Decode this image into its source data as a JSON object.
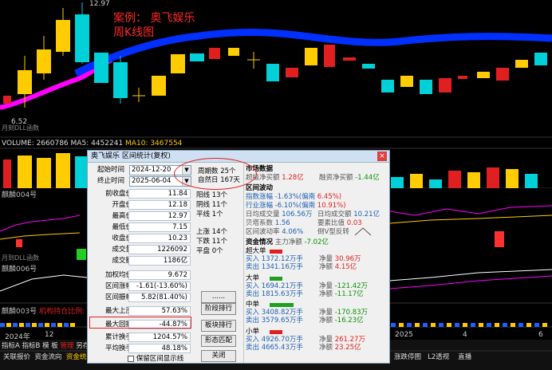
{
  "annotation": {
    "line1": "案例：  奥飞娱乐",
    "line2": "周K线图"
  },
  "chart_labels": {
    "high_price": "12.97",
    "low_price": "6.52",
    "ind1": "月刻DLL函数"
  },
  "volume_bar": {
    "volume": "VOLUME: 2660786",
    "ma5": "MA5: 4452241",
    "ma10": "MA10: 3467554"
  },
  "panels": {
    "p1": "麒麟004号",
    "p2": "麒麟006号",
    "p3": "月到DLL函数",
    "p4": "麒麟003号",
    "p4_ratio": "机构持仓比例: 39"
  },
  "date_axis": {
    "y2024": "2024年",
    "m12": "12",
    "y2025": "2025",
    "d4": "4",
    "d6": "6"
  },
  "bottom": {
    "row1": [
      "指标A",
      "指标B",
      "模",
      "板",
      "管理",
      "另存为"
    ],
    "row2": [
      "关联报价",
      "资金流向",
      "资金统"
    ],
    "right_tabs": [
      "涨跌停图",
      "L2透视",
      "直播"
    ]
  },
  "dialog": {
    "title": "奥飞娱乐  区间统计(复权)",
    "start_label": "起始时间",
    "start_value": "2024-12-20",
    "end_label": "终止时间",
    "end_value": "2025-06-04",
    "rows": [
      {
        "label": "前收盘价",
        "value": "11.84"
      },
      {
        "label": "开盘价",
        "value": "12.18"
      },
      {
        "label": "最高价",
        "value": "12.97"
      },
      {
        "label": "最低价",
        "value": "7.15"
      },
      {
        "label": "收盘价",
        "value": "10.23"
      },
      {
        "label": "成交量",
        "value": "1226092"
      },
      {
        "label": "成交额",
        "value": "1186亿"
      },
      {
        "label": "加权均价",
        "value": "9.672"
      },
      {
        "label": "区间涨幅",
        "value": "-1.61(-13.60%)"
      },
      {
        "label": "区间振幅",
        "value": "5.82(81.40%)"
      },
      {
        "label": "最大上涨",
        "value": "57.63%"
      },
      {
        "label": "最大回撤",
        "value": "-44.87%"
      },
      {
        "label": "累计换手",
        "value": "1204.57%"
      },
      {
        "label": "平均换手",
        "value": "48.18%"
      }
    ],
    "period": {
      "weeks": "周期数  25个",
      "natural": "自然日  167天"
    },
    "mid": {
      "up": "阳线  13个",
      "down": "阴线  11个",
      "flat": "平线  1个",
      "rise": "上涨  14个",
      "fall": "下跌  11个",
      "level": "平盘  0个"
    },
    "show_check": "保留区间显示线",
    "buttons": {
      "more": "......",
      "phase": "阶段排行",
      "block": "板块排行",
      "shape": "形态匹配",
      "close": "关闭"
    },
    "market": {
      "title": "市场数据",
      "main_buy": "超级净买额",
      "main_buy_v": "1.28亿",
      "fin_buy": "融资净买额",
      "fin_buy_v": "-1.44亿"
    },
    "range": {
      "title": "区间波动",
      "index_up": "指数涨幅 -1.63%(偏南",
      "index_up_v": "6.45%)",
      "ind_up": "行业涨幅 -6.10%(偏南",
      "ind_up_v": "10.91%)",
      "avg_vol": "日均成交量",
      "avg_vol_v": "106.56万",
      "avg_amt": "日均成交额",
      "avg_amt_v": "10.21亿",
      "beta": "贝塔系数",
      "beta_v": "1.56",
      "reload": "要素比值",
      "reload_v": "0.03",
      "vol": "区间波动率",
      "vol_v": "4.06%",
      "shape": "倒V型反转"
    },
    "fund": {
      "title": "资金情况",
      "main_net": "主力净额",
      "main_net_v": "-7.02亿",
      "groups": [
        {
          "name": "超大单",
          "color": "#e02020",
          "buy": "买入 1372.12万手",
          "sell": "卖出 1341.16万手",
          "net": "净量",
          "net_v": "30.96万",
          "amt": "净额",
          "amt_v": "4.15亿"
        },
        {
          "name": "大单",
          "color": "#1f9e1f",
          "buy": "买入 1694.21万手",
          "sell": "卖出 1815.63万手",
          "net": "净量",
          "net_v": "-121.42万",
          "amt": "净额",
          "amt_v": "-11.17亿"
        },
        {
          "name": "中单",
          "color": "#1f9e1f",
          "buy": "买入 3408.82万手",
          "sell": "卖出 3579.65万手",
          "net": "净量",
          "net_v": "-170.83万",
          "amt": "净额",
          "amt_v": "-16.23亿"
        },
        {
          "name": "小单",
          "color": "#e02020",
          "buy": "买入 4926.70万手",
          "sell": "卖出 4665.43万手",
          "net": "净量",
          "net_v": "261.27万",
          "amt": "净额",
          "amt_v": "23.25亿"
        }
      ]
    }
  }
}
